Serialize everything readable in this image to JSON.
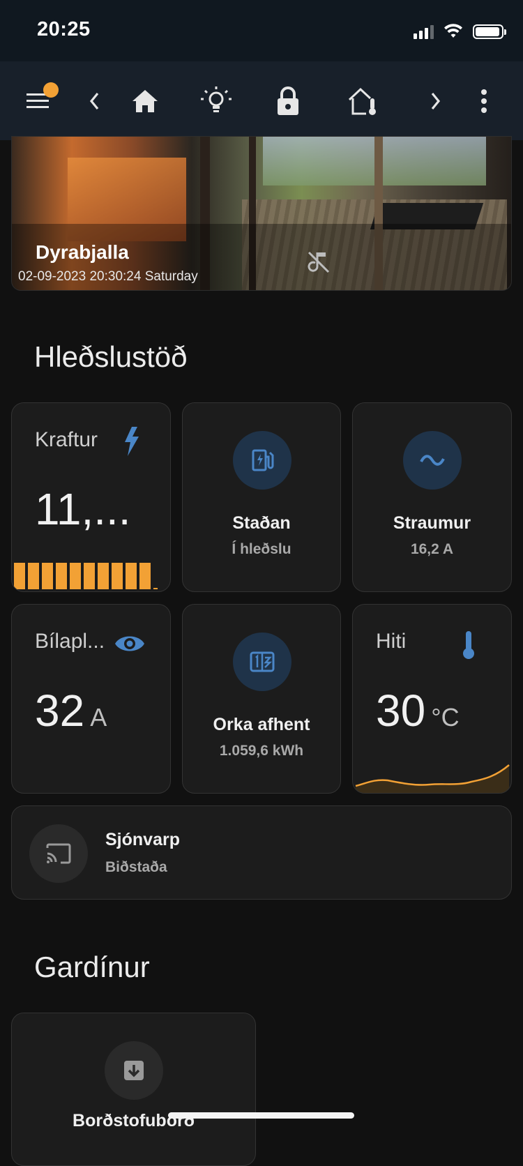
{
  "status": {
    "time": "20:25"
  },
  "toolbar": {
    "icons": [
      "menu-icon",
      "chevron-left-icon",
      "home-icon",
      "lightbulb-icon",
      "lock-icon",
      "home-thermometer-icon",
      "chevron-right-icon",
      "more-vertical-icon"
    ],
    "active_tab": "home",
    "accent_color": "#f2a135"
  },
  "camera": {
    "title": "Dyrabjalla",
    "timestamp": "02-09-2023 20:30:24 Saturday"
  },
  "section1": {
    "title": "Hleðslustöð",
    "power": {
      "label": "Kraftur",
      "value": "11,...",
      "icon": "flash-icon",
      "bar_fill_fraction": 0.92
    },
    "status_tile": {
      "name": "Staðan",
      "state": "Í hleðslu",
      "icon": "ev-station-icon"
    },
    "current_tile": {
      "name": "Straumur",
      "state": "16,2 A",
      "icon": "current-ac-icon"
    },
    "car_limit": {
      "label": "Bílapl...",
      "value": "32",
      "unit": "A",
      "icon": "eye-icon"
    },
    "energy_tile": {
      "name": "Orka afhent",
      "state": "1.059,6 kWh",
      "icon": "counter-icon"
    },
    "temperature": {
      "label": "Hiti",
      "value": "30",
      "unit": "°C",
      "icon": "thermometer-icon"
    },
    "media": {
      "name": "Sjónvarp",
      "state": "Biðstaða",
      "icon": "cast-icon"
    }
  },
  "section2": {
    "title": "Gardínur",
    "cover_tile": {
      "name": "Borðstofuborð",
      "icon": "arrow-down-box-icon"
    }
  },
  "colors": {
    "icon_blue": "#4a86c7",
    "icon_circle_bg": "#1f3349",
    "card_bg": "#1c1c1c",
    "orange": "#f2a135"
  }
}
